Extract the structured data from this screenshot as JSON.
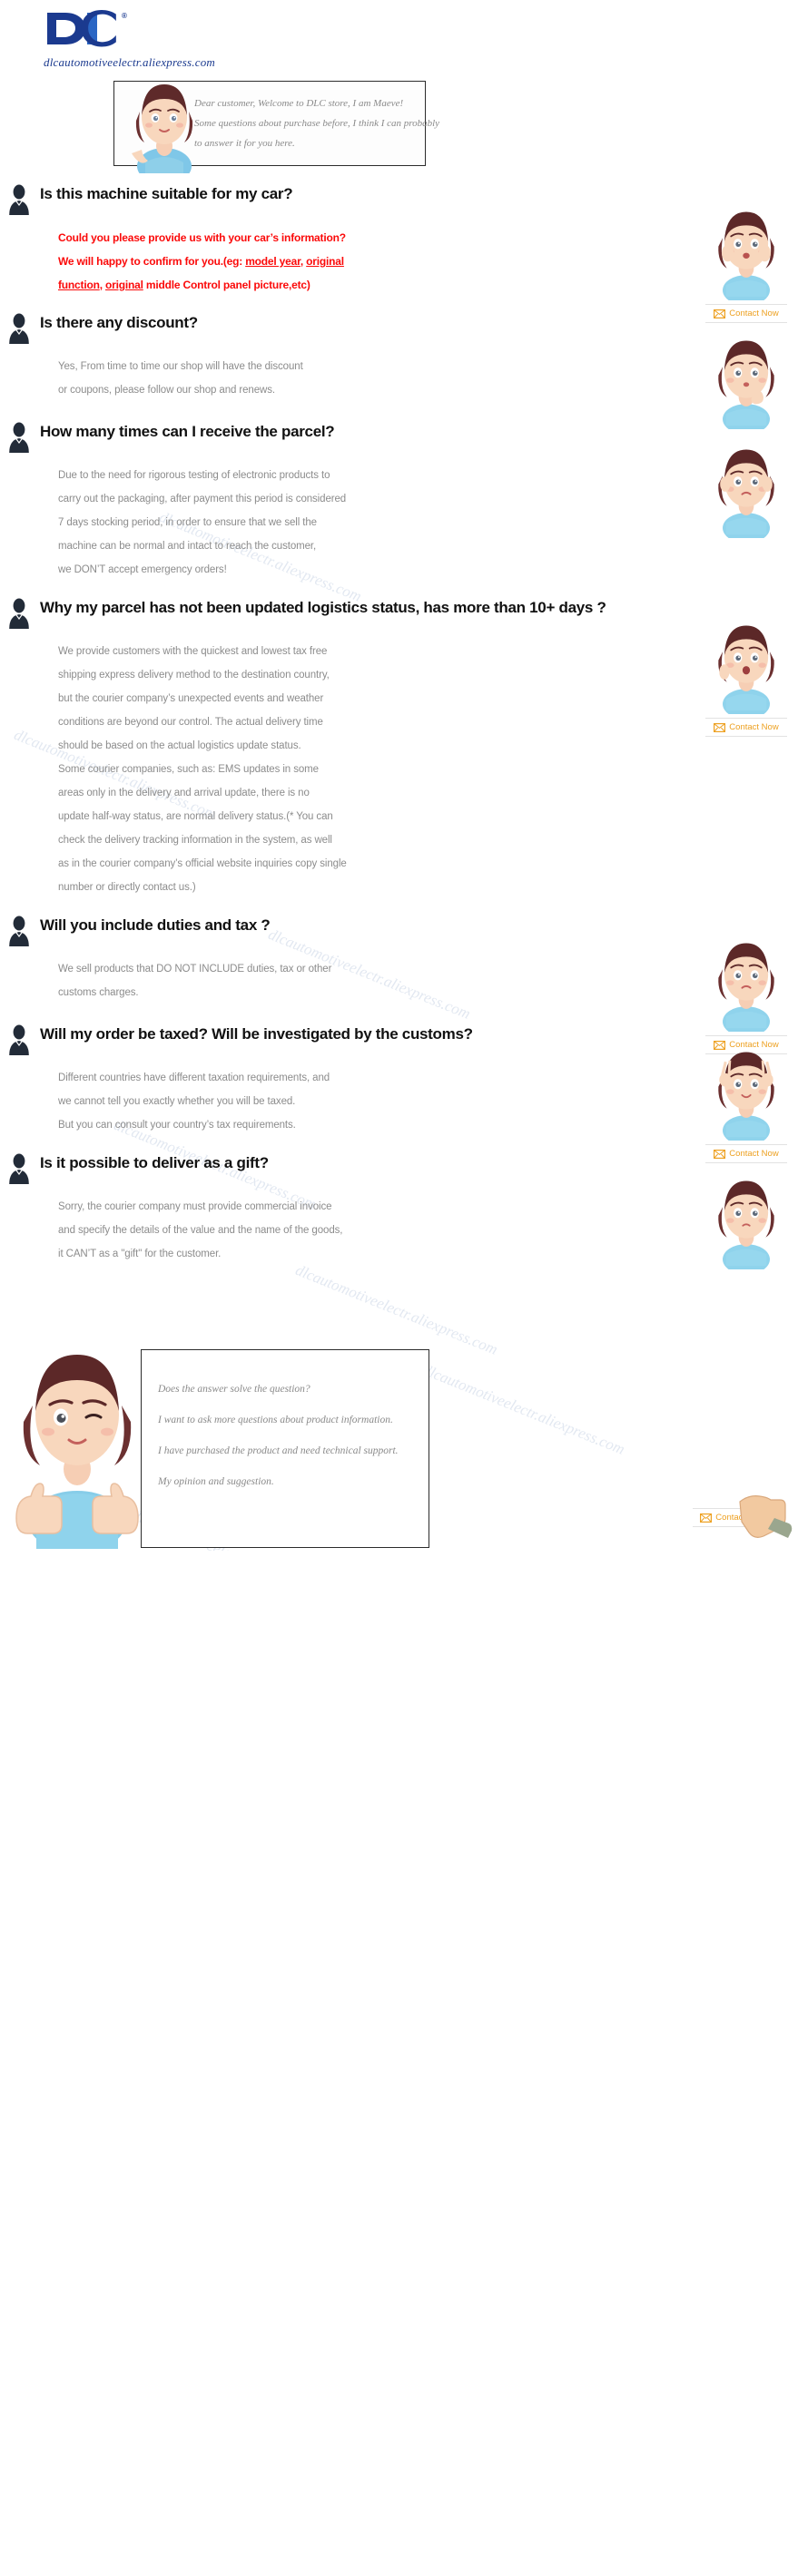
{
  "brand": {
    "logo_text": "DiC",
    "logo_registered": "®",
    "url": "dlcautomotiveelectr.aliexpress.com",
    "logo_color": "#1b3a8f"
  },
  "watermark": {
    "text": "dlcautomotiveelectr.aliexpress.com",
    "color": "#ccd6e6"
  },
  "welcome": {
    "line1": "Dear customer, Welcome to DLC store, I am Maeve!",
    "line2": "Some questions about purchase before, I think I can probably",
    "line3": "to answer it for you here."
  },
  "contact": {
    "label": "Contact Now",
    "icon": "envelope-icon",
    "color": "#eda020"
  },
  "faq": [
    {
      "id": "suitable-for-car",
      "question": "Is this machine suitable for my car?",
      "answer_style": "red",
      "answer_lines": [
        "Could you please provide us with your car’s information?",
        "We will happy to confirm for you.(eg: model year, original",
        "function, original middle Control panel picture,etc)"
      ],
      "has_contact": true,
      "avatar": "avatar-surprised"
    },
    {
      "id": "discount",
      "question": "Is there any discount?",
      "answer_style": "gray",
      "answer_lines": [
        "Yes, From time to time our shop will have the discount",
        "or coupons, please follow our shop and renews."
      ],
      "has_contact": false,
      "avatar": "avatar-thinking"
    },
    {
      "id": "receive-parcel-times",
      "question": "How many times can I receive the parcel?",
      "answer_style": "gray",
      "answer_lines": [
        "Due to the need for rigorous testing of electronic products to",
        "carry out the packaging, after payment this period is considered",
        "7 days stocking period, in order to ensure that we sell the",
        "machine can be normal and intact to reach the customer,",
        "we DON’T accept emergency orders!"
      ],
      "has_contact": false,
      "avatar": "avatar-worried"
    },
    {
      "id": "logistics-not-updated",
      "question": "Why my parcel has not been updated logistics status, has more than 10+ days ?",
      "answer_style": "gray",
      "answer_lines": [
        "We provide customers with the quickest and lowest tax free",
        "shipping express delivery method to the destination country,",
        "but the courier company’s unexpected events and weather",
        "conditions are beyond our control. The actual delivery time",
        "should be based on the actual logistics update status.",
        "Some courier companies, such as: EMS updates in some",
        "areas only in the delivery and arrival update, there is no",
        "update half-way status, are normal delivery status.(* You can",
        " check the delivery tracking information in the system, as well",
        "as in the courier company’s official website inquiries copy single",
        " number or directly contact us.)"
      ],
      "has_contact": true,
      "avatar": "avatar-shocked"
    },
    {
      "id": "duties-and-tax",
      "question": "Will you include duties and tax ?",
      "answer_style": "gray",
      "answer_lines": [
        "We sell products that DO NOT INCLUDE duties, tax or other",
        "customs charges."
      ],
      "has_contact": true,
      "avatar": "avatar-sad"
    },
    {
      "id": "order-taxed-customs",
      "question": "Will my order be taxed? Will be investigated by the customs?",
      "answer_style": "gray",
      "answer_lines": [
        "Different countries have different taxation requirements, and",
        " we cannot tell you exactly whether you will be taxed.",
        "But you can consult your country’s tax requirements."
      ],
      "has_contact": true,
      "avatar": "avatar-peace"
    },
    {
      "id": "deliver-as-gift",
      "question": " Is it possible to deliver as a gift?",
      "answer_style": "gray",
      "answer_lines": [
        "Sorry, the courier company must provide commercial invoice",
        "and specify the details of the value and the name of the goods,",
        "it CAN’T as a \"gift\" for the customer."
      ],
      "has_contact": false,
      "avatar": "avatar-pout"
    }
  ],
  "footer": {
    "lines": [
      "Does the answer solve the question?",
      "I want to ask more questions about product information.",
      "I have purchased the product and need technical support.",
      "My opinion and suggestion."
    ]
  }
}
